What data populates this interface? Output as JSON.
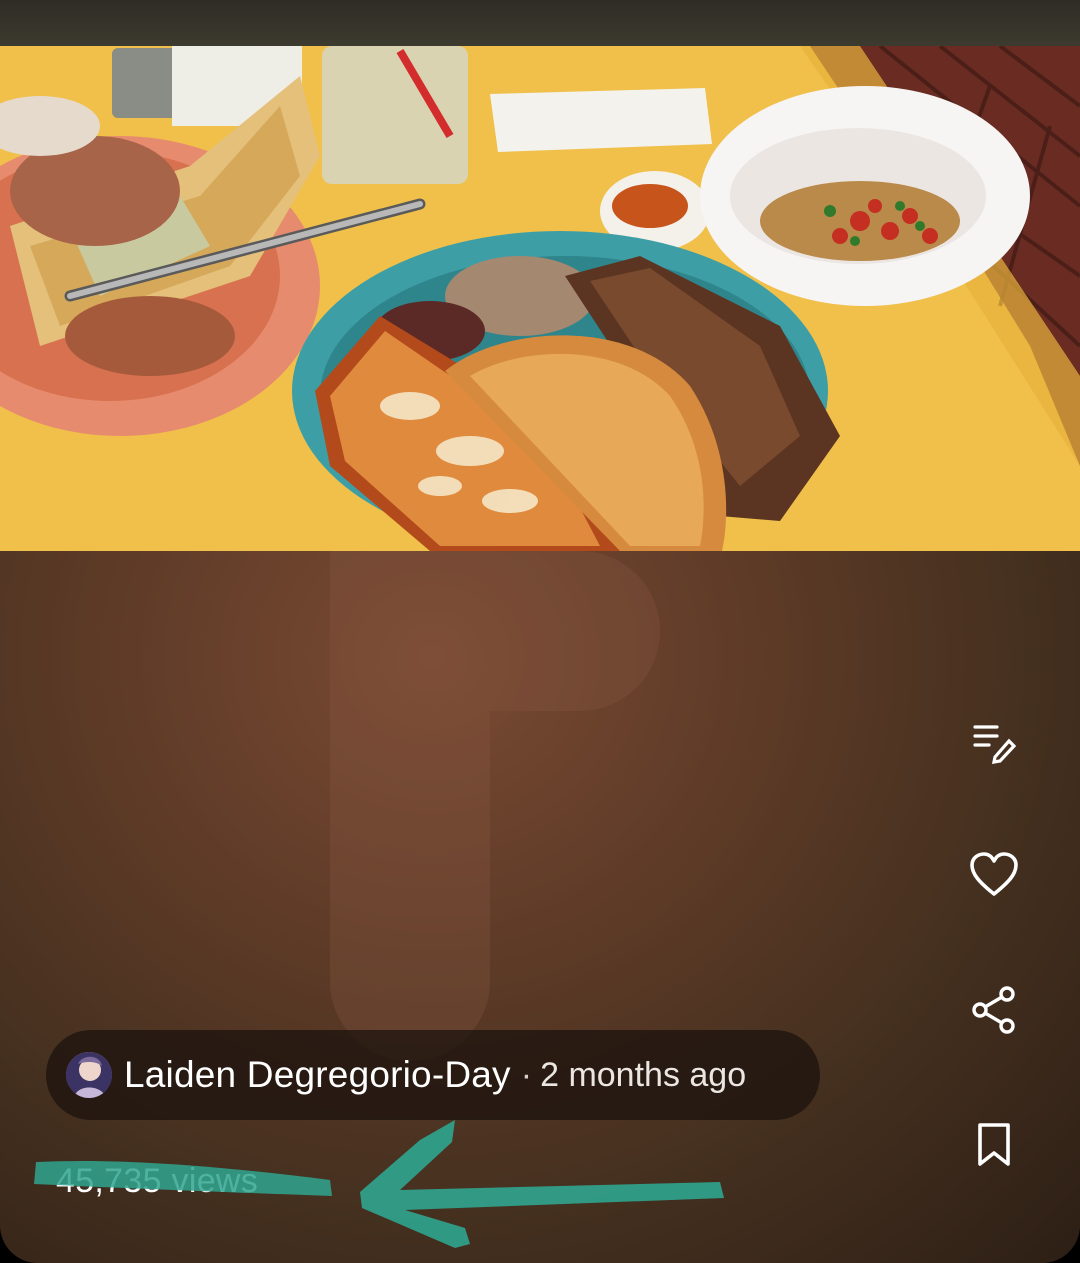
{
  "post": {
    "author_name": "Laiden Degregorio-Day",
    "separator": "·",
    "time_ago": "2 months ago",
    "views_text": "45,735 views"
  },
  "actions": [
    {
      "name": "edit-caption-icon"
    },
    {
      "name": "heart-icon"
    },
    {
      "name": "share-icon"
    },
    {
      "name": "bookmark-icon"
    }
  ],
  "colors": {
    "highlight_marker": "#2fa58f",
    "table_yellow": "#f2c24a",
    "plate_teal": "#3e9ea6",
    "plate_coral": "#e78b6f"
  }
}
